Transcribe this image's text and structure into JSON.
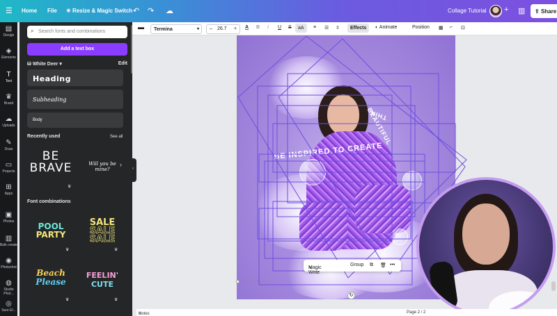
{
  "topbar": {
    "home": "Home",
    "file": "File",
    "resize": "Resize & Magic Switch",
    "project_title": "Collage Tutorial",
    "share": "Share"
  },
  "rail": [
    {
      "label": "Design",
      "icon": "design-icon",
      "glyph": "▤"
    },
    {
      "label": "Elements",
      "icon": "elements-icon",
      "glyph": "◈"
    },
    {
      "label": "Text",
      "icon": "text-icon",
      "glyph": "T"
    },
    {
      "label": "Brand",
      "icon": "brand-icon",
      "glyph": "♛"
    },
    {
      "label": "Uploads",
      "icon": "uploads-icon",
      "glyph": "☁"
    },
    {
      "label": "Draw",
      "icon": "draw-icon",
      "glyph": "✎"
    },
    {
      "label": "Projects",
      "icon": "projects-icon",
      "glyph": "▭"
    },
    {
      "label": "Apps",
      "icon": "apps-icon",
      "glyph": "⊞"
    },
    {
      "label": "Photos",
      "icon": "photos-icon",
      "glyph": "▣"
    },
    {
      "label": "Bulk create",
      "icon": "bulk-create-icon",
      "glyph": "▥"
    },
    {
      "label": "Photoshot",
      "icon": "photoshot-icon",
      "glyph": "◉"
    },
    {
      "label": "Studio Phot...",
      "icon": "studio-photo-icon",
      "glyph": "◍"
    },
    {
      "label": "Sure El...",
      "icon": "app-icon",
      "glyph": "◎"
    }
  ],
  "panel": {
    "search_placeholder": "Search fonts and combinations",
    "add_text": "Add a text box",
    "brand_kit": "White Deer",
    "edit": "Edit",
    "heading": "Heading",
    "subheading": "Subheading",
    "body": "Body",
    "recently_used": "Recently used",
    "see_all": "See all",
    "font_combinations": "Font combinations",
    "thumbs": {
      "be": "BE",
      "brave": "BRAVE",
      "will_you": "Will you be mine?",
      "pool": "POOL",
      "party": "PARTY",
      "sale": "SALE",
      "beach": "Beach",
      "please": "Please",
      "feelin": "FEELIN'",
      "cute": "CUTE"
    }
  },
  "toolbar": {
    "font": "Termina",
    "font_size": "26.7",
    "minus": "–",
    "plus": "+",
    "bold": "B",
    "italic": "I",
    "underline": "U",
    "strike": "S",
    "case": "aA",
    "effects": "Effects",
    "animate": "Animate",
    "position": "Position"
  },
  "canvas": {
    "curved_text_1": "BE INSPIRED TO CREATE",
    "curved_text_2": "BEAUTIFUL",
    "curved_text_3": "THIN"
  },
  "context_menu": {
    "magic_write": "Magic Write",
    "group": "Group",
    "more": "•••"
  },
  "bottom": {
    "notes": "Notes",
    "page": "Page 2 / 2"
  },
  "colors": {
    "accent_purple": "#8b3dff",
    "selection": "#7d4fe0",
    "panel_bg": "#252627",
    "rail_bg": "#18191b"
  }
}
